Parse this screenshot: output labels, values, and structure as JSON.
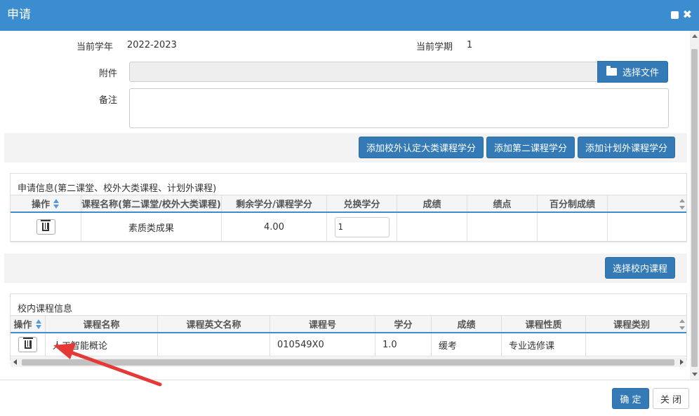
{
  "dialog": {
    "title": "申请"
  },
  "form": {
    "current_year_label": "当前学年",
    "current_year_value": "2022-2023",
    "current_term_label": "当前学期",
    "current_term_value": "1",
    "attachment_label": "附件",
    "attachment_value": "",
    "select_file_label": "选择文件",
    "remark_label": "备注",
    "remark_value": ""
  },
  "toolbar": {
    "add_external_label": "添加校外认定大类课程学分",
    "add_second_label": "添加第二课程学分",
    "add_plan_external_label": "添加计划外课程学分"
  },
  "application_panel": {
    "title": "申请信息(第二课堂、校外大类课程、计划外课程)",
    "columns": [
      "操作",
      "课程名称(第二课堂/校外大类课程)",
      "剩余学分/课程学分",
      "兑换学分",
      "成绩",
      "绩点",
      "百分制成绩"
    ],
    "rows": [
      {
        "course": "素质类成果",
        "remaining_credits": "4.00",
        "exchange_credits": "1",
        "score": "",
        "gpa": "",
        "percent_score": ""
      }
    ]
  },
  "select_course": {
    "button_label": "选择校内课程"
  },
  "internal_panel": {
    "title": "校内课程信息",
    "columns": [
      "操作",
      "课程名称",
      "课程英文名称",
      "课程号",
      "学分",
      "成绩",
      "课程性质",
      "课程类别"
    ],
    "rows": [
      {
        "name": "人工智能概论",
        "english_name": "",
        "code": "010549X0",
        "credits": "1.0",
        "score": "缓考",
        "nature": "专业选修课",
        "category": ""
      }
    ]
  },
  "footer": {
    "confirm_label": "确 定",
    "close_label": "关 闭"
  },
  "colors": {
    "primary": "#337ab7",
    "titlebar": "#3c8dcf",
    "annotation_arrow": "#e53935"
  },
  "icons": {
    "folder": "folder-open-icon",
    "trash": "trash-icon",
    "sort": "sort-icon",
    "maximize": "maximize-icon",
    "close": "close-icon"
  }
}
